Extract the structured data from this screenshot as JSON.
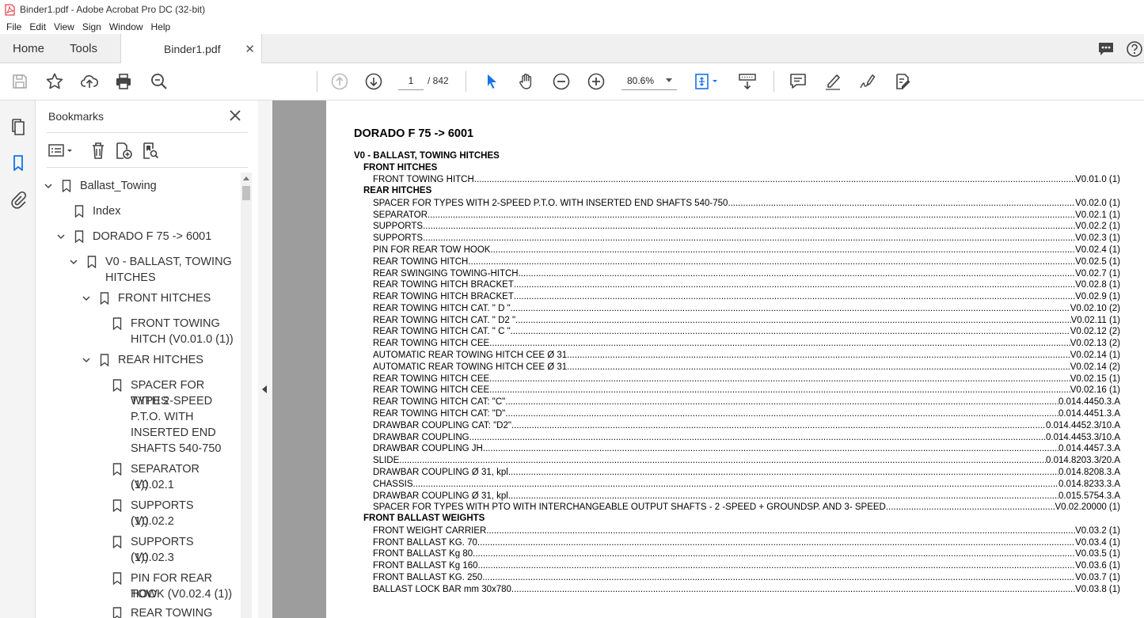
{
  "window": {
    "title": "Binder1.pdf - Adobe Acrobat Pro DC (32-bit)"
  },
  "menu": [
    "File",
    "Edit",
    "View",
    "Sign",
    "Window",
    "Help"
  ],
  "tabs": {
    "home": "Home",
    "tools": "Tools",
    "document": "Binder1.pdf"
  },
  "toolbar": {
    "page_current": "1",
    "page_total": "/ 842",
    "zoom": "80.6%"
  },
  "bookmarks": {
    "header": "Bookmarks",
    "items": [
      {
        "label": "Ballast_Towing"
      },
      {
        "label": "Index"
      },
      {
        "label": "DORADO F 75 -> 6001"
      },
      {
        "label_l1": "V0 - BALLAST, TOWING",
        "label_l2": "HITCHES"
      },
      {
        "label": "FRONT HITCHES"
      },
      {
        "label_l1": "FRONT TOWING",
        "label_l2": "HITCH (V0.01.0 (1))"
      },
      {
        "label": "REAR HITCHES"
      },
      {
        "label_l1": "SPACER FOR TYPES",
        "label_l2": "WITH 2-SPEED",
        "label_l3": "P.T.O. WITH",
        "label_l4": "INSERTED END",
        "label_l5": "SHAFTS 540-750"
      },
      {
        "label_l1": "SEPARATOR (V0.02.1",
        "label_l2": "(1))"
      },
      {
        "label_l1": "SUPPORTS (V0.02.2",
        "label_l2": "(1))"
      },
      {
        "label_l1": "SUPPORTS (V0.02.3",
        "label_l2": "(1))"
      },
      {
        "label_l1": "PIN FOR REAR TOW",
        "label_l2": "HOOK (V0.02.4 (1))"
      },
      {
        "label": "REAR TOWING"
      }
    ]
  },
  "document": {
    "title": "DORADO F 75 -> 6001",
    "section": "V0 - BALLAST, TOWING HITCHES",
    "groups": [
      {
        "heading": "FRONT HITCHES",
        "rows": [
          {
            "name": "FRONT TOWING HITCH",
            "code": "V0.01.0 (1)"
          }
        ]
      },
      {
        "heading": "REAR HITCHES",
        "rows": [
          {
            "name": "SPACER FOR TYPES WITH 2-SPEED P.T.O. WITH INSERTED END SHAFTS 540-750",
            "code": "V0.02.0 (1)"
          },
          {
            "name": "SEPARATOR",
            "code": "V0.02.1 (1)"
          },
          {
            "name": "SUPPORTS",
            "code": "V0.02.2 (1)"
          },
          {
            "name": "SUPPORTS",
            "code": "V0.02.3 (1)"
          },
          {
            "name": "PIN FOR REAR TOW HOOK",
            "code": "V0.02.4 (1)"
          },
          {
            "name": "REAR TOWING HITCH",
            "code": "V0.02.5 (1)"
          },
          {
            "name": "REAR SWINGING TOWING-HITCH",
            "code": "V0.02.7 (1)"
          },
          {
            "name": "REAR TOWING HITCH BRACKET",
            "code": "V0.02.8 (1)"
          },
          {
            "name": "REAR TOWING HITCH BRACKET",
            "code": "V0.02.9 (1)"
          },
          {
            "name": "REAR TOWING HITCH CAT. \" D \"",
            "code": "V0.02.10 (2)"
          },
          {
            "name": "REAR TOWING HITCH CAT. \" D2 \"",
            "code": "V0.02.11 (1)"
          },
          {
            "name": "REAR TOWING HITCH CAT. \" C \"",
            "code": "V0.02.12 (2)"
          },
          {
            "name": "REAR TOWING HITCH CEE",
            "code": "V0.02.13 (2)"
          },
          {
            "name": "AUTOMATIC REAR TOWING HITCH CEE Ø 31",
            "code": "V0.02.14 (1)"
          },
          {
            "name": "AUTOMATIC REAR TOWING HITCH CEE Ø 31",
            "code": "V0.02.14 (2)"
          },
          {
            "name": "REAR TOWING HITCH CEE",
            "code": "V0.02.15 (1)"
          },
          {
            "name": "REAR TOWING HITCH CEE",
            "code": "V0.02.16 (1)"
          },
          {
            "name": "REAR TOWING HITCH CAT: \"C\"",
            "code": "0.014.4450.3.A"
          },
          {
            "name": "REAR TOWING HITCH CAT: \"D\"",
            "code": "0.014.4451.3.A"
          },
          {
            "name": "DRAWBAR COUPLING CAT: \"D2\"",
            "code": "0.014.4452.3/10.A"
          },
          {
            "name": "DRAWBAR COUPLING",
            "code": "0.014.4453.3/10.A"
          },
          {
            "name": "DRAWBAR COUPLING JH",
            "code": "0.014.4457.3.A"
          },
          {
            "name": "SLIDE",
            "code": "0.014.8203.3/20.A"
          },
          {
            "name": "DRAWBAR COUPLING Ø 31, kpl",
            "code": "0.014.8208.3.A"
          },
          {
            "name": "CHASSIS",
            "code": "0.014.8233.3.A"
          },
          {
            "name": "DRAWBAR COUPLING Ø 31, kpl",
            "code": "0.015.5754.3.A"
          },
          {
            "name": "SPACER FOR TYPES WITH PTO WITH INTERCHANGEABLE OUTPUT SHAFTS - 2 -SPEED + GROUNDSP. AND 3- SPEED",
            "code": "V0.02.20000 (1)"
          }
        ]
      },
      {
        "heading": "FRONT BALLAST WEIGHTS",
        "rows": [
          {
            "name": "FRONT WEIGHT CARRIER",
            "code": "V0.03.2 (1)"
          },
          {
            "name": "FRONT BALLAST KG. 70",
            "code": "V0.03.4 (1)"
          },
          {
            "name": "FRONT BALLAST Kg 80",
            "code": "V0.03.5 (1)"
          },
          {
            "name": "FRONT BALLAST Kg 160",
            "code": "V0.03.6 (1)"
          },
          {
            "name": "FRONT BALLAST KG. 250",
            "code": "V0.03.7 (1)"
          },
          {
            "name": "BALLAST LOCK BAR mm 30x780",
            "code": "V0.03.8 (1)"
          }
        ]
      }
    ]
  },
  "colors": {
    "accent": "#1473e6",
    "acrobat_red": "#e34850",
    "viewer_bg": "#9d9d9d"
  }
}
